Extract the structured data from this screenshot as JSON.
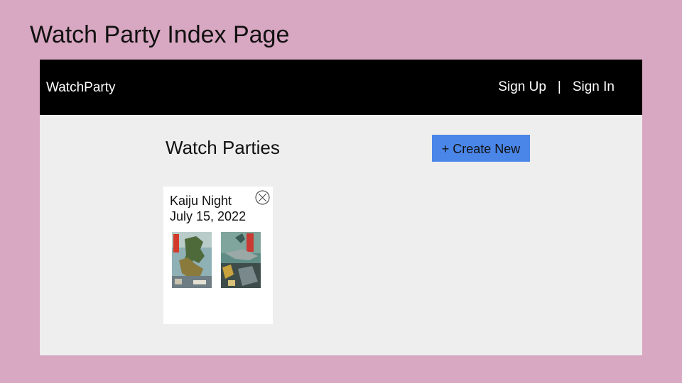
{
  "slide": {
    "title": "Watch Party Index Page"
  },
  "navbar": {
    "brand": "WatchParty",
    "sign_up": "Sign Up",
    "separator": "|",
    "sign_in": "Sign In"
  },
  "main": {
    "heading": "Watch Parties",
    "create_button": "+ Create New"
  },
  "parties": [
    {
      "title": "Kaiju Night",
      "date": "July 15, 2022",
      "delete_icon": "circle-x-icon",
      "posters": [
        "movie-poster",
        "movie-poster"
      ]
    }
  ],
  "colors": {
    "slide_background": "#d8a7c1",
    "navbar": "#000000",
    "content_background": "#eeeeee",
    "create_button": "#4a86e8"
  }
}
